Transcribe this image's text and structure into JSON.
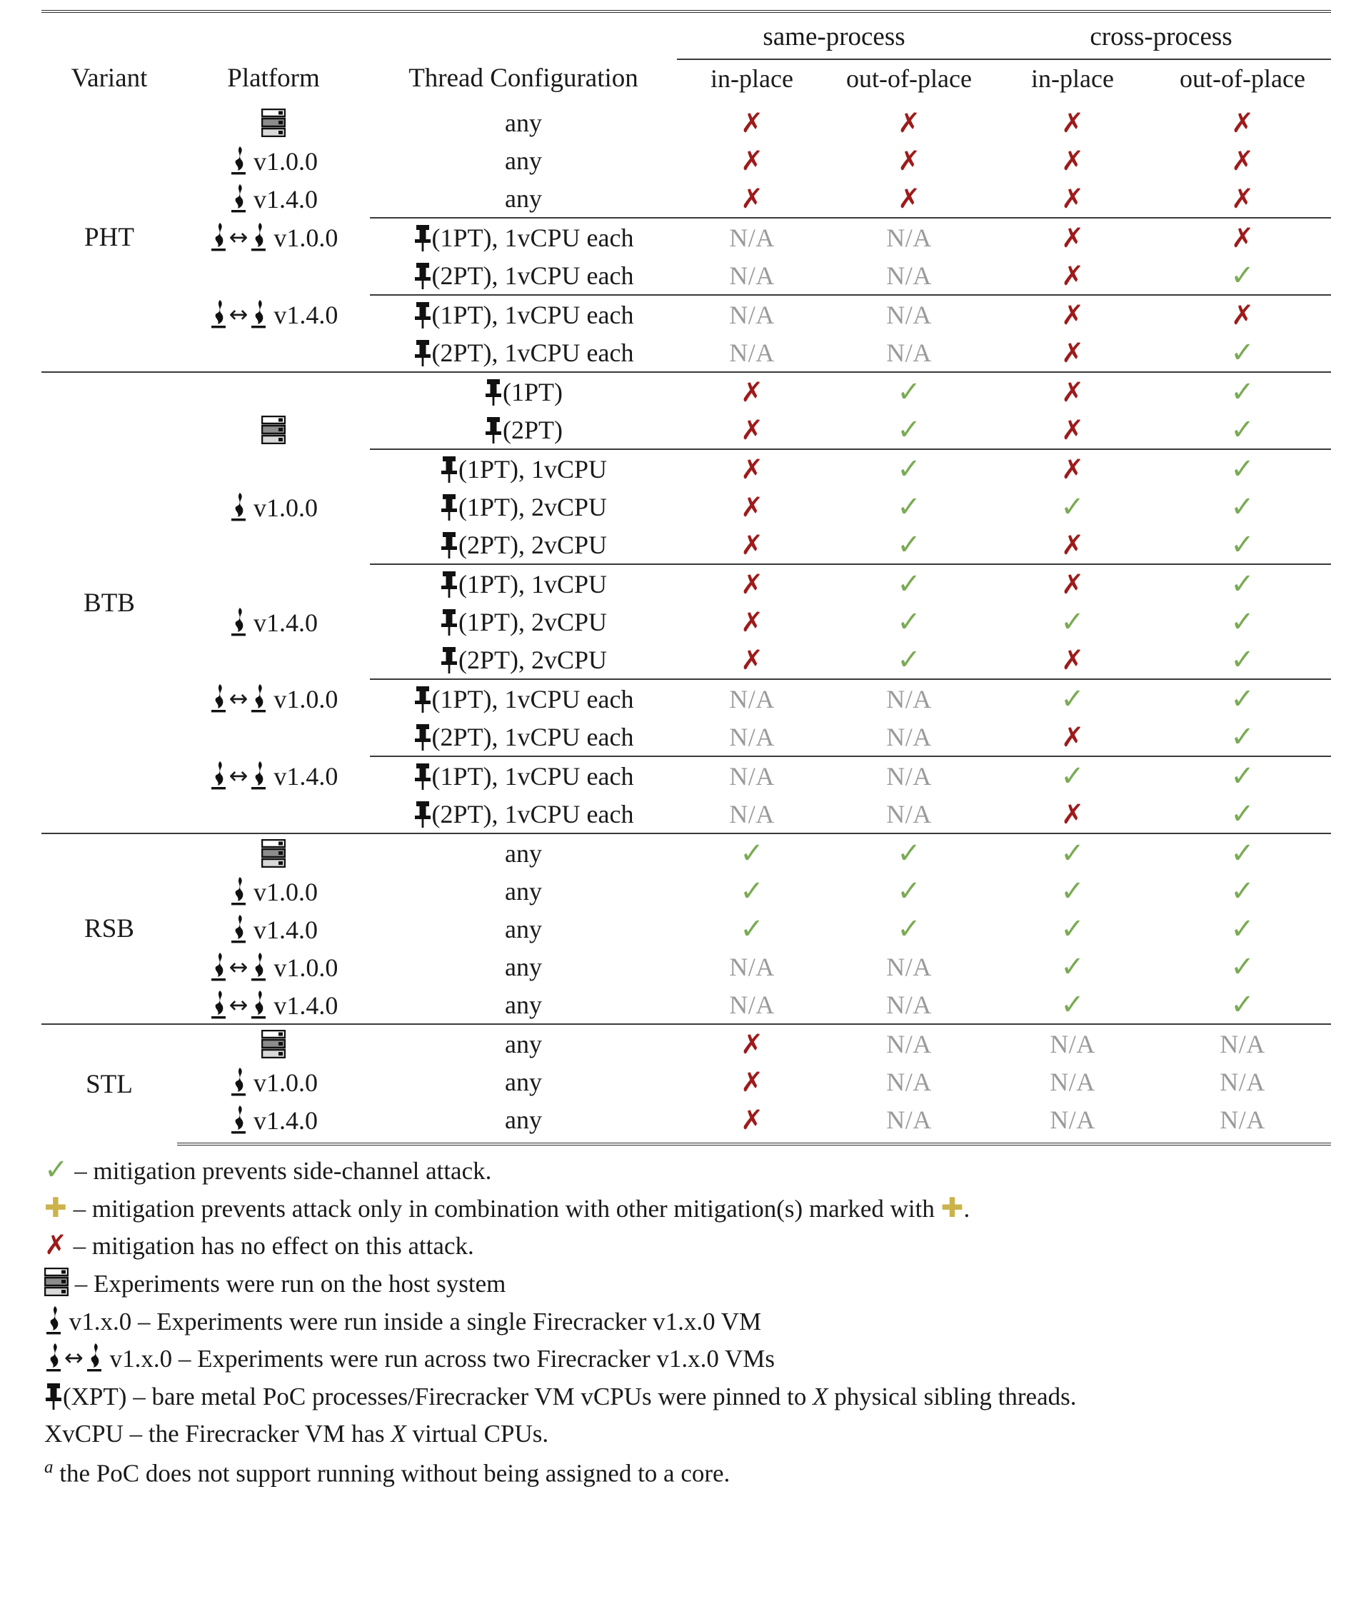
{
  "table": {
    "headers": {
      "variant": "Variant",
      "platform": "Platform",
      "thread_configuration": "Thread Configuration",
      "group_same_process": "same-process",
      "group_cross_process": "cross-process",
      "sub_in_place": "in-place",
      "sub_out_of_place": "out-of-place"
    },
    "symbols": {
      "check": "✓",
      "cross": "✗",
      "na": "N/A",
      "plus": "✚"
    },
    "platform_labels": {
      "host": "",
      "fc_100": "v1.0.0",
      "fc_140": "v1.4.0",
      "fc2_100": "v1.0.0",
      "fc2_140": "v1.4.0"
    },
    "thread_labels": {
      "any": "any",
      "pt1": "(1PT)",
      "pt2": "(2PT)",
      "pt1_1vcpu": "(1PT), 1vCPU",
      "pt1_2vcpu": "(1PT), 2vCPU",
      "pt2_2vcpu": "(2PT), 2vCPU",
      "pt1_1vcpu_each": "(1PT), 1vCPU each",
      "pt2_1vcpu_each": "(2PT), 1vCPU each"
    },
    "sections": [
      {
        "variant": "PHT",
        "groups": [
          {
            "rows": [
              {
                "platform_icon": "server",
                "platform_label": "",
                "thread_icon": "none",
                "thread_label": "any",
                "values": [
                  "cross",
                  "cross",
                  "cross",
                  "cross"
                ]
              },
              {
                "platform_icon": "firecracker",
                "platform_label": "v1.0.0",
                "thread_icon": "none",
                "thread_label": "any",
                "values": [
                  "cross",
                  "cross",
                  "cross",
                  "cross"
                ]
              },
              {
                "platform_icon": "firecracker",
                "platform_label": "v1.4.0",
                "thread_icon": "none",
                "thread_label": "any",
                "values": [
                  "cross",
                  "cross",
                  "cross",
                  "cross"
                ]
              }
            ]
          },
          {
            "rows": [
              {
                "platform_icon": "firecracker2",
                "platform_label": "v1.0.0",
                "thread_icon": "pin",
                "thread_label": "(1PT), 1vCPU each",
                "values": [
                  "na",
                  "na",
                  "cross",
                  "cross"
                ]
              },
              {
                "platform_icon": "none",
                "platform_label": "",
                "thread_icon": "pin",
                "thread_label": "(2PT), 1vCPU each",
                "values": [
                  "na",
                  "na",
                  "cross",
                  "check"
                ]
              }
            ]
          },
          {
            "rows": [
              {
                "platform_icon": "firecracker2",
                "platform_label": "v1.4.0",
                "thread_icon": "pin",
                "thread_label": "(1PT), 1vCPU each",
                "values": [
                  "na",
                  "na",
                  "cross",
                  "cross"
                ]
              },
              {
                "platform_icon": "none",
                "platform_label": "",
                "thread_icon": "pin",
                "thread_label": "(2PT), 1vCPU each",
                "values": [
                  "na",
                  "na",
                  "cross",
                  "check"
                ]
              }
            ]
          }
        ]
      },
      {
        "variant": "BTB",
        "groups": [
          {
            "rows": [
              {
                "platform_icon": "none",
                "platform_label": "",
                "thread_icon": "pin",
                "thread_label": "(1PT)",
                "values": [
                  "cross",
                  "check",
                  "cross",
                  "check"
                ]
              },
              {
                "platform_icon": "server",
                "platform_label": "",
                "thread_icon": "pin",
                "thread_label": "(2PT)",
                "values": [
                  "cross",
                  "check",
                  "cross",
                  "check"
                ]
              }
            ]
          },
          {
            "rows": [
              {
                "platform_icon": "none",
                "platform_label": "",
                "thread_icon": "pin",
                "thread_label": "(1PT), 1vCPU",
                "values": [
                  "cross",
                  "check",
                  "cross",
                  "check"
                ]
              },
              {
                "platform_icon": "firecracker",
                "platform_label": "v1.0.0",
                "thread_icon": "pin",
                "thread_label": "(1PT), 2vCPU",
                "values": [
                  "cross",
                  "check",
                  "check",
                  "check"
                ]
              },
              {
                "platform_icon": "none",
                "platform_label": "",
                "thread_icon": "pin",
                "thread_label": "(2PT), 2vCPU",
                "values": [
                  "cross",
                  "check",
                  "cross",
                  "check"
                ]
              }
            ]
          },
          {
            "rows": [
              {
                "platform_icon": "none",
                "platform_label": "",
                "thread_icon": "pin",
                "thread_label": "(1PT), 1vCPU",
                "values": [
                  "cross",
                  "check",
                  "cross",
                  "check"
                ]
              },
              {
                "platform_icon": "firecracker",
                "platform_label": "v1.4.0",
                "thread_icon": "pin",
                "thread_label": "(1PT), 2vCPU",
                "values": [
                  "cross",
                  "check",
                  "check",
                  "check"
                ]
              },
              {
                "platform_icon": "none",
                "platform_label": "",
                "thread_icon": "pin",
                "thread_label": "(2PT), 2vCPU",
                "values": [
                  "cross",
                  "check",
                  "cross",
                  "check"
                ]
              }
            ]
          },
          {
            "rows": [
              {
                "platform_icon": "firecracker2",
                "platform_label": "v1.0.0",
                "thread_icon": "pin",
                "thread_label": "(1PT), 1vCPU each",
                "values": [
                  "na",
                  "na",
                  "check",
                  "check"
                ]
              },
              {
                "platform_icon": "none",
                "platform_label": "",
                "thread_icon": "pin",
                "thread_label": "(2PT), 1vCPU each",
                "values": [
                  "na",
                  "na",
                  "cross",
                  "check"
                ]
              }
            ]
          },
          {
            "rows": [
              {
                "platform_icon": "firecracker2",
                "platform_label": "v1.4.0",
                "thread_icon": "pin",
                "thread_label": "(1PT), 1vCPU each",
                "values": [
                  "na",
                  "na",
                  "check",
                  "check"
                ]
              },
              {
                "platform_icon": "none",
                "platform_label": "",
                "thread_icon": "pin",
                "thread_label": "(2PT), 1vCPU each",
                "values": [
                  "na",
                  "na",
                  "cross",
                  "check"
                ]
              }
            ]
          }
        ]
      },
      {
        "variant": "RSB",
        "groups": [
          {
            "rows": [
              {
                "platform_icon": "server",
                "platform_label": "",
                "thread_icon": "none",
                "thread_label": "any",
                "values": [
                  "check",
                  "check",
                  "check",
                  "check"
                ]
              },
              {
                "platform_icon": "firecracker",
                "platform_label": "v1.0.0",
                "thread_icon": "none",
                "thread_label": "any",
                "values": [
                  "check",
                  "check",
                  "check",
                  "check"
                ]
              },
              {
                "platform_icon": "firecracker",
                "platform_label": "v1.4.0",
                "thread_icon": "none",
                "thread_label": "any",
                "values": [
                  "check",
                  "check",
                  "check",
                  "check"
                ]
              },
              {
                "platform_icon": "firecracker2",
                "platform_label": "v1.0.0",
                "thread_icon": "none",
                "thread_label": "any",
                "values": [
                  "na",
                  "na",
                  "check",
                  "check"
                ]
              },
              {
                "platform_icon": "firecracker2",
                "platform_label": "v1.4.0",
                "thread_icon": "none",
                "thread_label": "any",
                "values": [
                  "na",
                  "na",
                  "check",
                  "check"
                ]
              }
            ]
          }
        ]
      },
      {
        "variant": "STL",
        "groups": [
          {
            "rows": [
              {
                "platform_icon": "server",
                "platform_label": "",
                "thread_icon": "none",
                "thread_label": "any",
                "values": [
                  "cross",
                  "na",
                  "na",
                  "na"
                ]
              },
              {
                "platform_icon": "firecracker",
                "platform_label": "v1.0.0",
                "thread_icon": "none",
                "thread_label": "any",
                "values": [
                  "cross",
                  "na",
                  "na",
                  "na"
                ]
              },
              {
                "platform_icon": "firecracker",
                "platform_label": "v1.4.0",
                "thread_icon": "none",
                "thread_label": "any",
                "values": [
                  "cross",
                  "na",
                  "na",
                  "na"
                ]
              }
            ]
          }
        ]
      }
    ]
  },
  "legend": {
    "lines": [
      {
        "icon": "check",
        "text": "– mitigation prevents side-channel attack."
      },
      {
        "icon": "plus",
        "text": "– mitigation prevents attack only in combination with other mitigation(s) marked with",
        "trailing_icon": "plus",
        "tail": "."
      },
      {
        "icon": "cross",
        "text": "– mitigation has no effect on this attack."
      },
      {
        "icon": "server",
        "text": "– Experiments were run on the host system"
      },
      {
        "icon": "firecracker",
        "prefix": "v1.x.0",
        "text": "– Experiments were run inside a single Firecracker v1.x.0 VM"
      },
      {
        "icon": "firecracker2",
        "prefix": "v1.x.0",
        "text": "– Experiments were run across two Firecracker v1.x.0 VMs"
      },
      {
        "icon": "pin",
        "prefix": "(XPT)",
        "text": "– bare metal PoC processes/Firecracker VM vCPUs were pinned to X physical sibling threads."
      },
      {
        "icon": "none",
        "prefix": "XvCPU",
        "text": "– the Firecracker VM has X virtual CPUs."
      },
      {
        "icon": "sup-a",
        "text": "the PoC does not support running without being assigned to a core."
      }
    ]
  },
  "colors": {
    "check": "#7aab54",
    "cross": "#9e1b1b",
    "na": "#9a9a9a",
    "plus": "#cbb34a",
    "rule": "#2a2a2a",
    "text": "#1a1a1a"
  }
}
